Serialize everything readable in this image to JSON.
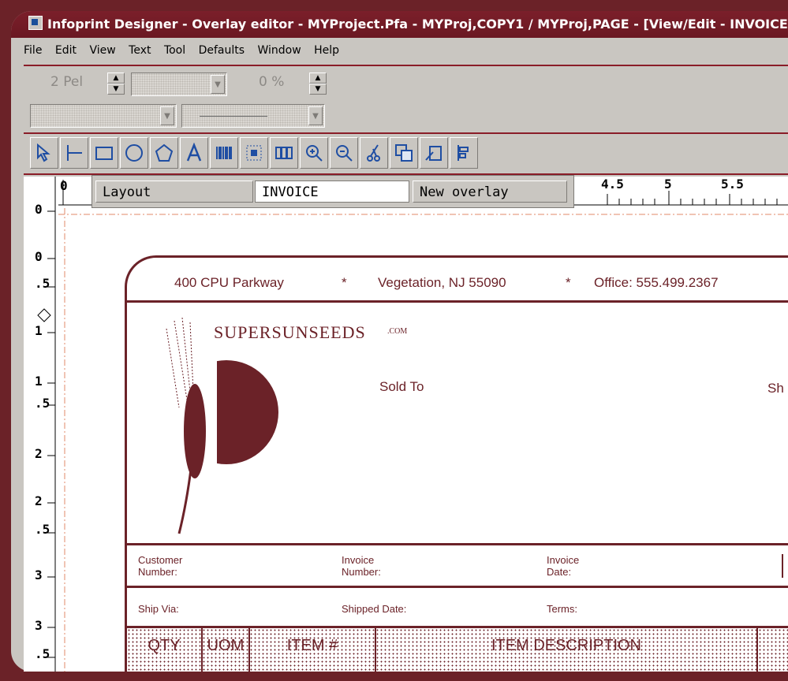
{
  "window": {
    "title": "Infoprint Designer - Overlay editor - MYProject.Pfa - MYProj,COPY1 / MYProj,PAGE - [View/Edit - INVOICE]"
  },
  "menu": [
    "File",
    "Edit",
    "View",
    "Text",
    "Tool",
    "Defaults",
    "Window",
    "Help"
  ],
  "toolbar": {
    "line_width": "2 Pel",
    "percent": "0 %"
  },
  "tabs": {
    "layout": "Layout",
    "name": "INVOICE",
    "new_overlay": "New overlay"
  },
  "ruler": {
    "horizontal": [
      "0",
      "4.5",
      "5",
      "5.5"
    ],
    "vertical": [
      "0",
      "0",
      ".5",
      "1",
      "1",
      ".5",
      "2",
      "2",
      ".5",
      "3",
      "3",
      ".5"
    ]
  },
  "form": {
    "address": "400 CPU Parkway",
    "star1": "*",
    "city": "Vegetation, NJ 55090",
    "star2": "*",
    "office": "Office:  555.499.2367",
    "brand": "SUPERSUNSEEDS",
    "brand_suffix": ".COM",
    "sold_to": "Sold To",
    "ship_to_partial": "Sh",
    "customer_number": [
      "Customer",
      "Number:"
    ],
    "invoice_number": [
      "Invoice",
      "Number:"
    ],
    "invoice_date": [
      "Invoice",
      "Date:"
    ],
    "ship_via": "Ship Via:",
    "shipped_date": "Shipped Date:",
    "terms": "Terms:",
    "col_qty": "QTY",
    "col_uom": "UOM",
    "col_item": "ITEM #",
    "col_desc": "ITEM DESCRIPTION"
  },
  "colors": {
    "frame": "#6b2228",
    "accent": "#1f4ea3"
  }
}
